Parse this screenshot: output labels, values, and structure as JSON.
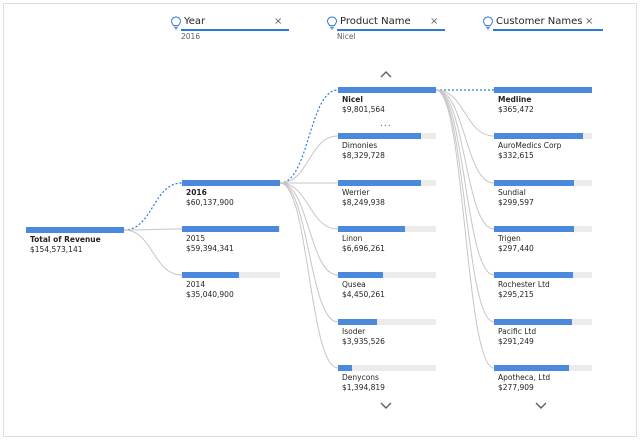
{
  "filters": [
    {
      "title": "Year",
      "selected": "2016",
      "icon": "lightbulb-icon",
      "close": "×"
    },
    {
      "title": "Product Name",
      "selected": "Nicel",
      "icon": "lightbulb-icon",
      "close": "×"
    },
    {
      "title": "Customer Names",
      "selected": "",
      "icon": "lightbulb-icon",
      "close": "×"
    }
  ],
  "root": {
    "label": "Total of Revenue",
    "value": "$154,573,141",
    "fraction": 1.0
  },
  "years": [
    {
      "label": "2016",
      "value": "$60,137,900",
      "fraction": 1.0,
      "selected": true
    },
    {
      "label": "2015",
      "value": "$59,394,341",
      "fraction": 0.988
    },
    {
      "label": "2014",
      "value": "$35,040,900",
      "fraction": 0.583
    }
  ],
  "products": [
    {
      "label": "Nicel",
      "value": "$9,801,564",
      "fraction": 1.0,
      "selected": true
    },
    {
      "label": "Dimonies",
      "value": "$8,329,728",
      "fraction": 0.85
    },
    {
      "label": "Werrier",
      "value": "$8,249,938",
      "fraction": 0.842
    },
    {
      "label": "Linon",
      "value": "$6,696,261",
      "fraction": 0.683
    },
    {
      "label": "Qusea",
      "value": "$4,450,261",
      "fraction": 0.454
    },
    {
      "label": "Isoder",
      "value": "$3,935,526",
      "fraction": 0.402
    },
    {
      "label": "Denycons",
      "value": "$1,394,819",
      "fraction": 0.142
    }
  ],
  "customers": [
    {
      "label": "Medline",
      "value": "$365,472",
      "fraction": 1.0,
      "selected": true
    },
    {
      "label": "AuroMedics Corp",
      "value": "$332,615",
      "fraction": 0.91
    },
    {
      "label": "Sundial",
      "value": "$299,597",
      "fraction": 0.82
    },
    {
      "label": "Trigen",
      "value": "$297,440",
      "fraction": 0.814
    },
    {
      "label": "Rochester Ltd",
      "value": "$295,215",
      "fraction": 0.808
    },
    {
      "label": "Pacific Ltd",
      "value": "$291,249",
      "fraction": 0.797
    },
    {
      "label": "Apotheca, Ltd",
      "value": "$277,909",
      "fraction": 0.76
    }
  ],
  "more_indicator": "...",
  "colors": {
    "bar": "#4a89dc",
    "track": "#ebebeb",
    "accent": "#2f78d8",
    "link": "#c8c6c4",
    "active_link": "#2f78d8"
  },
  "nav_icons": [
    "chevron-up-icon",
    "chevron-down-icon"
  ]
}
